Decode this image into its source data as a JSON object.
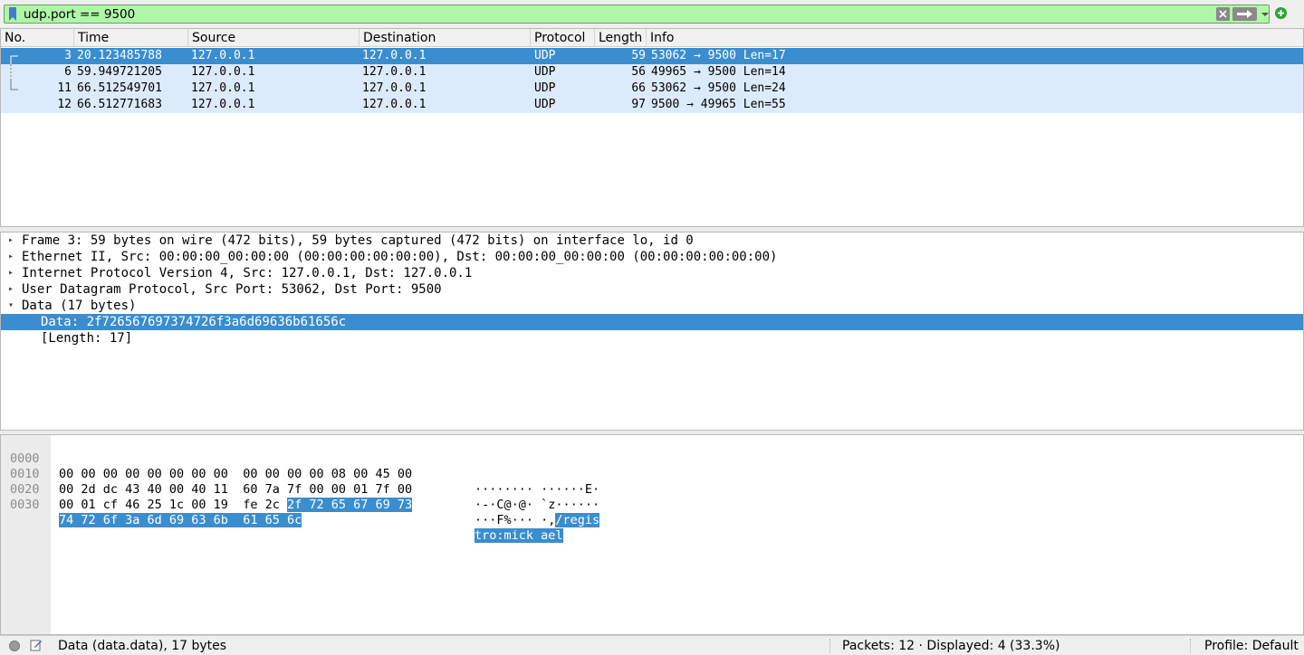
{
  "filter": {
    "value": "udp.port == 9500",
    "colors": {
      "valid_bg": "#aff6a9"
    }
  },
  "packet_list": {
    "columns": [
      "No.",
      "Time",
      "Source",
      "Destination",
      "Protocol",
      "Length",
      "Info"
    ],
    "rows": [
      {
        "no": "3",
        "time": "20.123485788",
        "source": "127.0.0.1",
        "destination": "127.0.0.1",
        "protocol": "UDP",
        "length": "59",
        "info": "53062 → 9500 Len=17",
        "selected": true
      },
      {
        "no": "6",
        "time": "59.949721205",
        "source": "127.0.0.1",
        "destination": "127.0.0.1",
        "protocol": "UDP",
        "length": "56",
        "info": "49965 → 9500 Len=14",
        "selected": false
      },
      {
        "no": "11",
        "time": "66.512549701",
        "source": "127.0.0.1",
        "destination": "127.0.0.1",
        "protocol": "UDP",
        "length": "66",
        "info": "53062 → 9500 Len=24",
        "selected": false
      },
      {
        "no": "12",
        "time": "66.512771683",
        "source": "127.0.0.1",
        "destination": "127.0.0.1",
        "protocol": "UDP",
        "length": "97",
        "info": "9500 → 49965 Len=55",
        "selected": false
      }
    ]
  },
  "details": {
    "frame": "Frame 3: 59 bytes on wire (472 bits), 59 bytes captured (472 bits) on interface lo, id 0",
    "ethernet": "Ethernet II, Src: 00:00:00_00:00:00 (00:00:00:00:00:00), Dst: 00:00:00_00:00:00 (00:00:00:00:00:00)",
    "ip": "Internet Protocol Version 4, Src: 127.0.0.1, Dst: 127.0.0.1",
    "udp": "User Datagram Protocol, Src Port: 53062, Dst Port: 9500",
    "data": "Data (17 bytes)",
    "data_value": "Data: 2f726567697374726f3a6d69636b61656c",
    "data_length": "[Length: 17]"
  },
  "bytes": {
    "rows": [
      {
        "offset": "0000",
        "hex": "00 00 00 00 00 00 00 00  00 00 00 00 08 00 45 00",
        "hex_hl": "",
        "ascii": "········ ······E·",
        "ascii_hl": ""
      },
      {
        "offset": "0010",
        "hex": "00 2d dc 43 40 00 40 11  60 7a 7f 00 00 01 7f 00",
        "hex_hl": "",
        "ascii": "·-·C@·@· `z······",
        "ascii_hl": ""
      },
      {
        "offset": "0020",
        "hex": "00 01 cf 46 25 1c 00 19  fe 2c ",
        "hex_hl": "2f 72 65 67 69 73",
        "ascii": "···F%··· ·,",
        "ascii_hl": "/regis"
      },
      {
        "offset": "0030",
        "hex": "",
        "hex_hl": "74 72 6f 3a 6d 69 63 6b  61 65 6c",
        "ascii": "",
        "ascii_hl": "tro:mick ael"
      }
    ]
  },
  "status": {
    "field": "Data (data.data), 17 bytes",
    "packets": "Packets: 12 · Displayed: 4 (33.3%)",
    "profile": "Profile: Default"
  }
}
